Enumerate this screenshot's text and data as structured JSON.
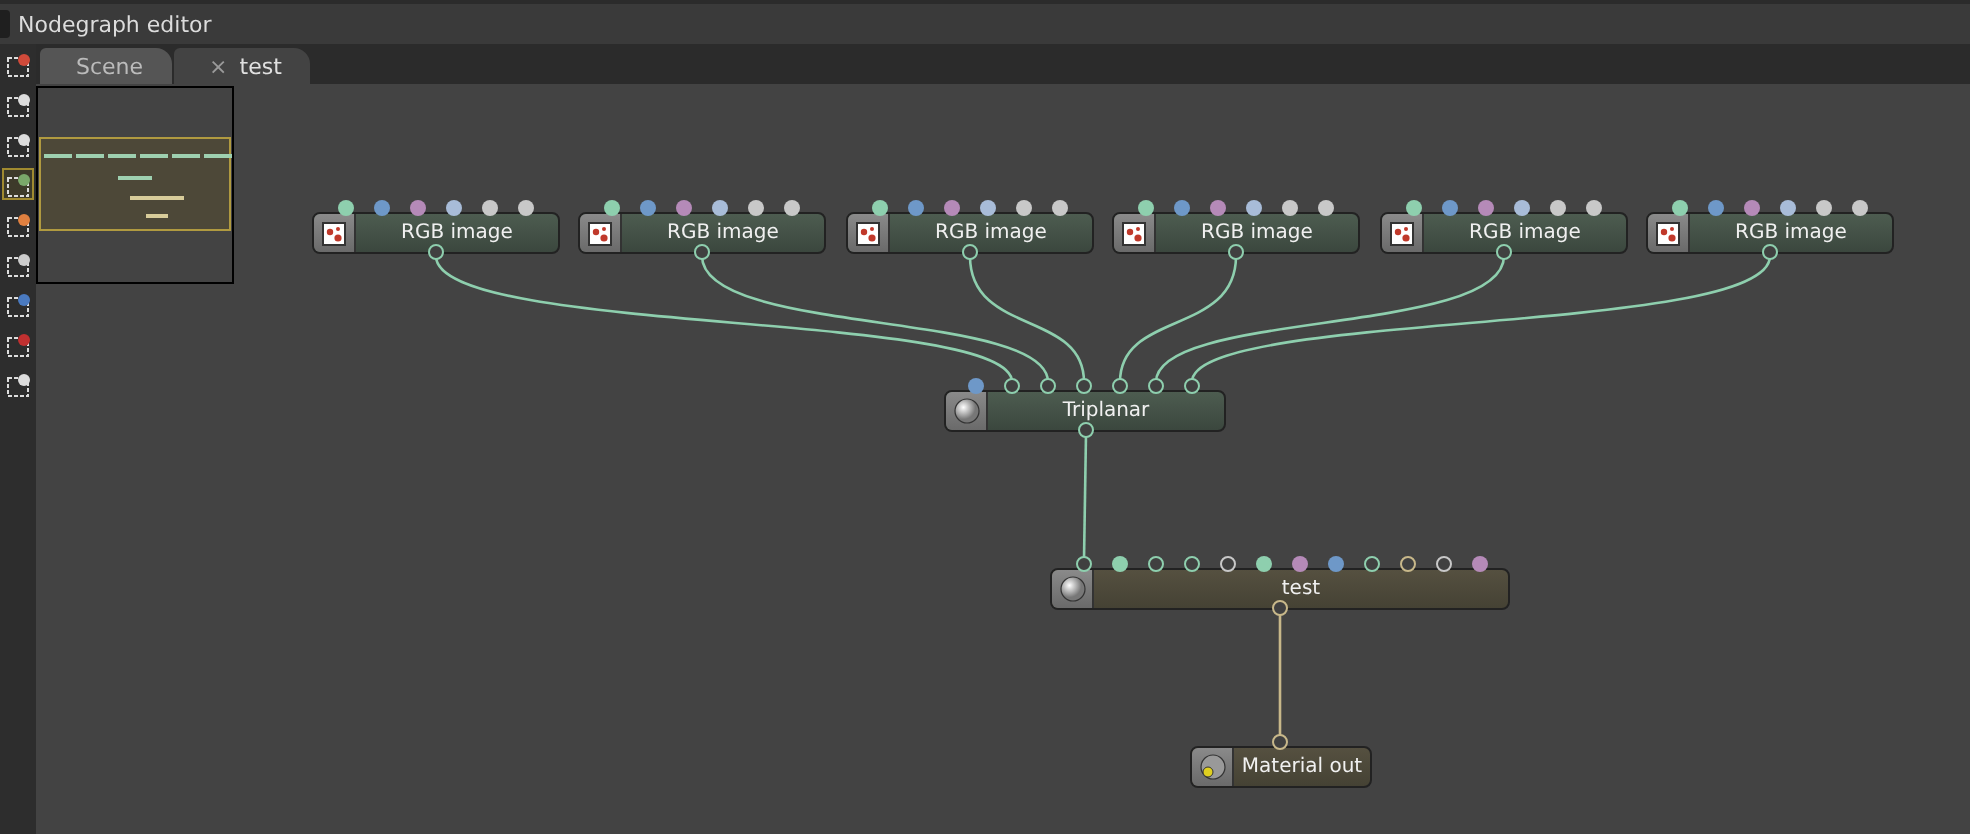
{
  "window": {
    "title": "Nodegraph editor"
  },
  "toolbar": [
    {
      "selected": false
    },
    {
      "selected": false
    },
    {
      "selected": false
    },
    {
      "selected": true
    },
    {
      "selected": false
    },
    {
      "selected": false
    },
    {
      "selected": false
    },
    {
      "selected": false
    },
    {
      "selected": false
    }
  ],
  "tabs": [
    {
      "label": "Scene",
      "selected": false
    },
    {
      "label": "test",
      "selected": true,
      "close": "×"
    }
  ],
  "nodes": [
    {
      "kind": "rgb-image",
      "label": "RGB image",
      "inputs": [
        {
          "color": "#8ecfae",
          "connected": false
        },
        {
          "color": "#6e98c8",
          "connected": false
        },
        {
          "color": "#b58ab8",
          "connected": false
        },
        {
          "color": "#a8bcd8",
          "connected": false
        },
        {
          "color": "#c8c8c8",
          "connected": false
        },
        {
          "color": "#c8c8c8",
          "connected": false
        }
      ],
      "output": {
        "color": "#8ecfae"
      }
    },
    {
      "kind": "rgb-image",
      "label": "RGB image",
      "inputs": [
        {
          "color": "#8ecfae",
          "connected": false
        },
        {
          "color": "#6e98c8",
          "connected": false
        },
        {
          "color": "#b58ab8",
          "connected": false
        },
        {
          "color": "#a8bcd8",
          "connected": false
        },
        {
          "color": "#c8c8c8",
          "connected": false
        },
        {
          "color": "#c8c8c8",
          "connected": false
        }
      ],
      "output": {
        "color": "#8ecfae"
      }
    },
    {
      "kind": "rgb-image",
      "label": "RGB image",
      "inputs": [
        {
          "color": "#8ecfae",
          "connected": false
        },
        {
          "color": "#6e98c8",
          "connected": false
        },
        {
          "color": "#b58ab8",
          "connected": false
        },
        {
          "color": "#a8bcd8",
          "connected": false
        },
        {
          "color": "#c8c8c8",
          "connected": false
        },
        {
          "color": "#c8c8c8",
          "connected": false
        }
      ],
      "output": {
        "color": "#8ecfae"
      }
    },
    {
      "kind": "rgb-image",
      "label": "RGB image",
      "inputs": [
        {
          "color": "#8ecfae",
          "connected": false
        },
        {
          "color": "#6e98c8",
          "connected": false
        },
        {
          "color": "#b58ab8",
          "connected": false
        },
        {
          "color": "#a8bcd8",
          "connected": false
        },
        {
          "color": "#c8c8c8",
          "connected": false
        },
        {
          "color": "#c8c8c8",
          "connected": false
        }
      ],
      "output": {
        "color": "#8ecfae"
      }
    },
    {
      "kind": "rgb-image",
      "label": "RGB image",
      "inputs": [
        {
          "color": "#8ecfae",
          "connected": false
        },
        {
          "color": "#6e98c8",
          "connected": false
        },
        {
          "color": "#b58ab8",
          "connected": false
        },
        {
          "color": "#a8bcd8",
          "connected": false
        },
        {
          "color": "#c8c8c8",
          "connected": false
        },
        {
          "color": "#c8c8c8",
          "connected": false
        }
      ],
      "output": {
        "color": "#8ecfae"
      }
    },
    {
      "kind": "rgb-image",
      "label": "RGB image",
      "inputs": [
        {
          "color": "#8ecfae",
          "connected": false
        },
        {
          "color": "#6e98c8",
          "connected": false
        },
        {
          "color": "#b58ab8",
          "connected": false
        },
        {
          "color": "#a8bcd8",
          "connected": false
        },
        {
          "color": "#c8c8c8",
          "connected": false
        },
        {
          "color": "#c8c8c8",
          "connected": false
        }
      ],
      "output": {
        "color": "#8ecfae"
      }
    },
    {
      "kind": "triplanar",
      "label": "Triplanar",
      "inputs": [
        {
          "color": "#6e98c8",
          "connected": false
        },
        {
          "color": "#8ecfae",
          "connected": true
        },
        {
          "color": "#8ecfae",
          "connected": true
        },
        {
          "color": "#8ecfae",
          "connected": true
        },
        {
          "color": "#8ecfae",
          "connected": true
        },
        {
          "color": "#8ecfae",
          "connected": true
        },
        {
          "color": "#8ecfae",
          "connected": true
        }
      ],
      "output": {
        "color": "#8ecfae"
      }
    },
    {
      "kind": "material",
      "label": "test",
      "inputs": [
        {
          "color": "#8ecfae",
          "connected": true
        },
        {
          "color": "#8ecfae",
          "connected": false
        },
        {
          "color": "#8ecfae",
          "connected": true
        },
        {
          "color": "#8ecfae",
          "connected": true
        },
        {
          "color": "#c8c8c8",
          "connected": true
        },
        {
          "color": "#8ecfae",
          "connected": false
        },
        {
          "color": "#b58ab8",
          "connected": false
        },
        {
          "color": "#6e98c8",
          "connected": false
        },
        {
          "color": "#8ecfae",
          "connected": true
        },
        {
          "color": "#c8b88a",
          "connected": true
        },
        {
          "color": "#c8c8c8",
          "connected": true
        },
        {
          "color": "#b58ab8",
          "connected": false
        }
      ],
      "output": {
        "color": "#c8b88a"
      }
    },
    {
      "kind": "output",
      "label": "Material out",
      "inputs": [
        {
          "color": "#c8b88a",
          "connected": true
        }
      ]
    }
  ]
}
